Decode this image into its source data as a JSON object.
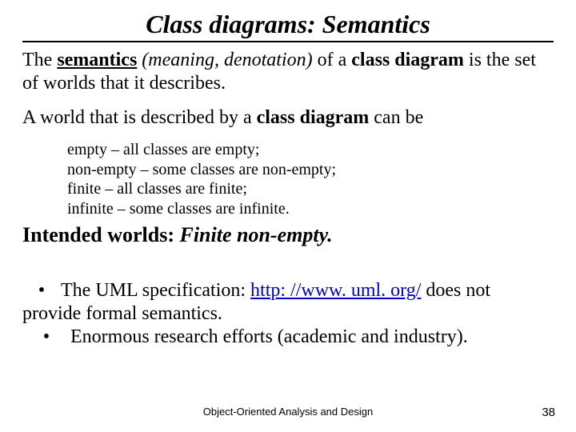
{
  "title": "Class diagrams: Semantics",
  "para1": {
    "pre": "The ",
    "semantics": "semantics",
    "paren": " (meaning, denotation)",
    "mid": " of a ",
    "classdiagram": "class diagram",
    "post": " is the set of worlds that it describes."
  },
  "para2": {
    "pre": "A world that is described by a ",
    "classdiagram": "class diagram",
    "post": " can be"
  },
  "worlds": [
    "empty – all classes are empty;",
    "non-empty – some classes are non-empty;",
    "finite – all classes are finite;",
    "infinite – some classes are infinite."
  ],
  "intended": {
    "label": "Intended worlds: ",
    "value": "Finite non-empty."
  },
  "bullets": {
    "b1_pre": "The UML specification:  ",
    "b1_link": "http: //www. uml. org/",
    "b1_post": "  does not provide formal semantics.",
    "b2": "Enormous research efforts (academic and industry)."
  },
  "footer": {
    "center": "Object-Oriented Analysis and Design",
    "page": "38"
  }
}
